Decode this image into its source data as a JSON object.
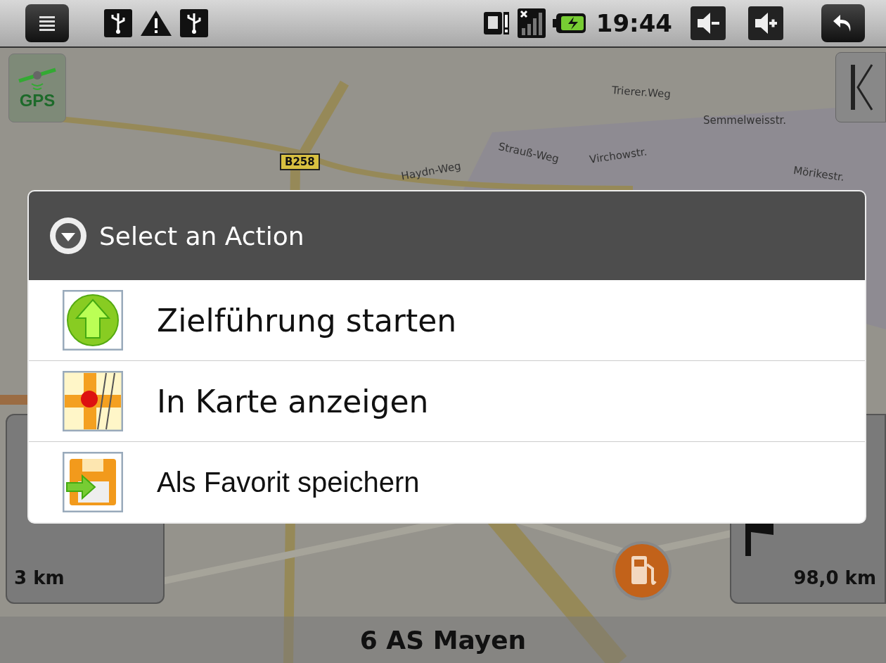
{
  "status_bar": {
    "time": "19:44"
  },
  "map": {
    "labels": [
      {
        "text": "Trierer.Weg",
        "kind": "street"
      },
      {
        "text": "Semmelweisstr.",
        "kind": "street"
      },
      {
        "text": "Strauß-Weg",
        "kind": "street"
      },
      {
        "text": "Virchowstr.",
        "kind": "street"
      },
      {
        "text": "Haydn-Weg",
        "kind": "street"
      },
      {
        "text": "Mörikestr.",
        "kind": "street"
      },
      {
        "text": "B258",
        "kind": "road_sign"
      }
    ],
    "gps_button": {
      "label": "GPS"
    },
    "left_panel": {
      "distance": "3 km"
    },
    "right_panel": {
      "distance": "98,0 km"
    },
    "next_street": "6 AS Mayen"
  },
  "dialog": {
    "title": "Select an Action",
    "items": [
      {
        "label": "Zielführung starten",
        "kind": "navigate"
      },
      {
        "label": "In Karte anzeigen",
        "kind": "map"
      },
      {
        "label": "Als Favorit speichern",
        "kind": "save"
      }
    ]
  }
}
